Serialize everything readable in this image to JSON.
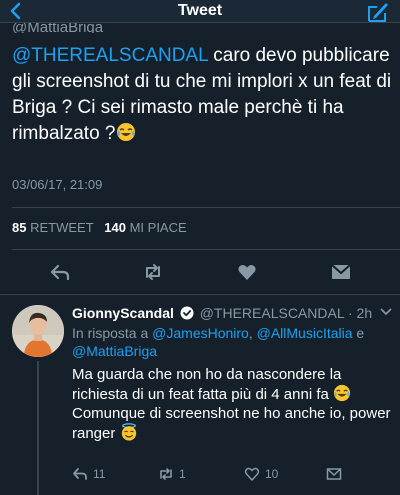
{
  "nav": {
    "title": "Tweet"
  },
  "main_tweet": {
    "clipped_handle": "@MattiaBriga",
    "mention": "@THEREALSCANDAL",
    "text": " caro devo pubblicare gli screenshot di tu che mi implori x un feat di Briga ? Ci sei rimasto male perchè ti ha rimbalzato ?",
    "timestamp": "03/06/17, 21:09",
    "retweets_count": "85",
    "retweets_label": "RETWEET",
    "likes_count": "140",
    "likes_label": "MI PIACE",
    "actions": [
      "reply-icon",
      "retweet-icon",
      "like-icon",
      "message-icon"
    ]
  },
  "reply": {
    "name": "GionnyScandal",
    "handle": "@THEREALSCANDAL",
    "age": "· 2h",
    "in_reply_prefix": "In risposta a ",
    "mentions": [
      "@JamesHoniro",
      "@AllMusicItalia",
      "@MattiaBriga"
    ],
    "sep_comma": ", ",
    "sep_and": " e ",
    "line1": "Ma guarda che non ho da nascondere la richiesta di un feat fatta più di 4 anni fa",
    "line2": "Comunque di screenshot ne ho anche io, power ranger",
    "reply_count": "11",
    "retweet_count": "1",
    "like_count": "10"
  },
  "colors": {
    "accent": "#1da1f2",
    "background": "#15202b",
    "muted": "#8899a6",
    "verified": "#ffffff"
  }
}
